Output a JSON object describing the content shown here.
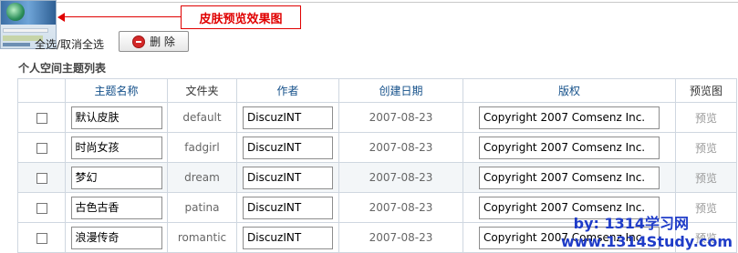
{
  "callout": {
    "label": "皮肤预览效果图"
  },
  "toolbar": {
    "select_all_label": "全选/取消全选",
    "delete_label": "删 除"
  },
  "section": {
    "title": "个人空间主题列表"
  },
  "table": {
    "headers": [
      "",
      "主题名称",
      "文件夹",
      "作者",
      "创建日期",
      "版权",
      "预览图"
    ],
    "rows": [
      {
        "name": "默认皮肤",
        "folder": "default",
        "author": "DiscuzINT",
        "date": "2007-08-23",
        "copyright": "Copyright 2007 Comsenz Inc.",
        "preview": "预览"
      },
      {
        "name": "时尚女孩",
        "folder": "fadgirl",
        "author": "DiscuzINT",
        "date": "2007-08-23",
        "copyright": "Copyright 2007 Comsenz Inc.",
        "preview": "预览"
      },
      {
        "name": "梦幻",
        "folder": "dream",
        "author": "DiscuzINT",
        "date": "2007-08-23",
        "copyright": "Copyright 2007 Comsenz Inc.",
        "preview": "预览"
      },
      {
        "name": "古色古香",
        "folder": "patina",
        "author": "DiscuzINT",
        "date": "2007-08-23",
        "copyright": "Copyright 2007 Comsenz Inc.",
        "preview": "预览"
      },
      {
        "name": "浪漫传奇",
        "folder": "romantic",
        "author": "DiscuzINT",
        "date": "2007-08-23",
        "copyright": "Copyright 2007 Comsenz Inc.",
        "preview": "预览"
      }
    ]
  },
  "watermark": {
    "line1": "by: 1314学习网",
    "line2": "www.1314Study.com"
  },
  "colors": {
    "accent_red": "#e00000",
    "header_blue": "#14508a",
    "watermark_blue": "#1f3cc8"
  }
}
